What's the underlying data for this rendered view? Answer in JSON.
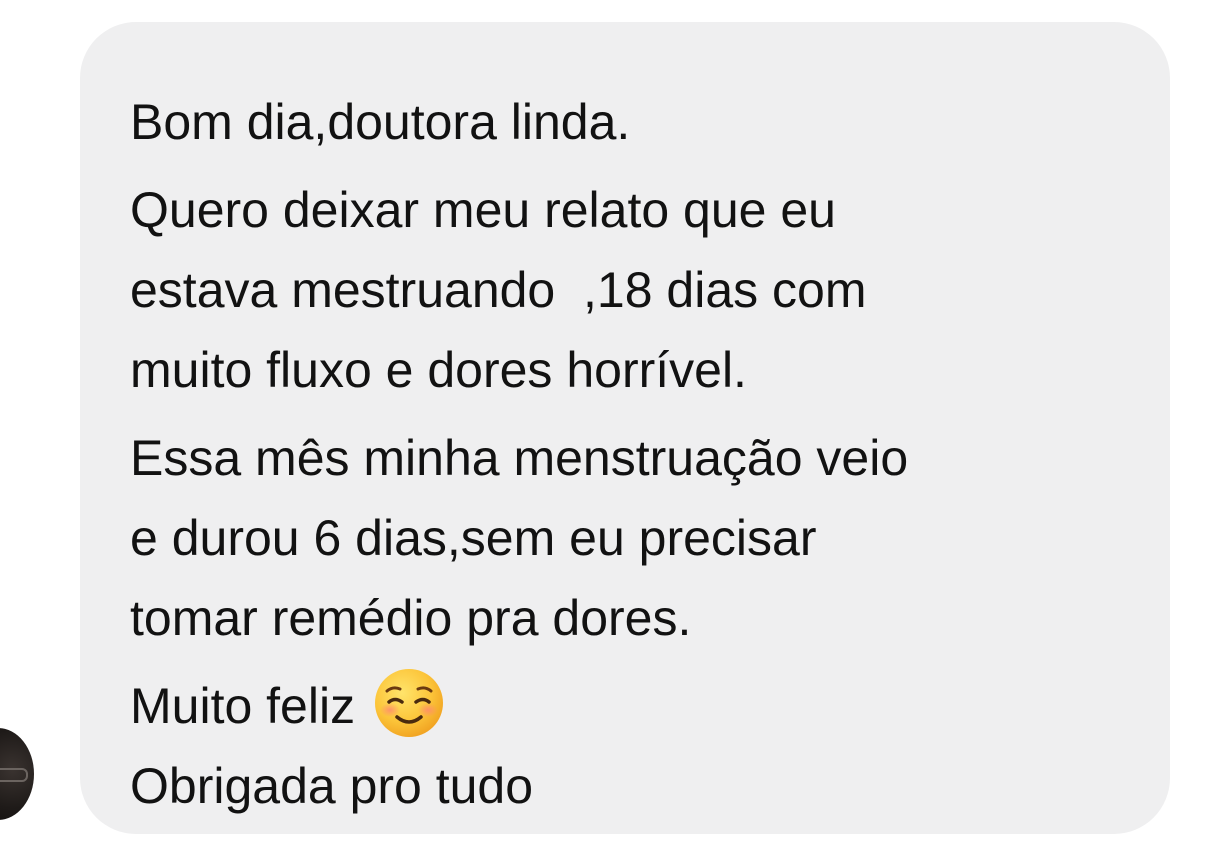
{
  "message": {
    "lines": [
      "Bom dia,doutora linda.",
      "Quero deixar meu relato que eu",
      "estava mestruando  ,18 dias com",
      "muito fluxo e dores horrível.",
      "Essa mês minha menstruação veio",
      "e durou 6 dias,sem eu precisar",
      "tomar remédio pra dores.",
      "Muito feliz",
      "Obrigada pro tudo"
    ],
    "emoji": "smiling-face-with-blush-icon",
    "bubble_color": "#efeff0",
    "text_color": "#121212"
  },
  "sender": {
    "avatar": "avatar"
  }
}
